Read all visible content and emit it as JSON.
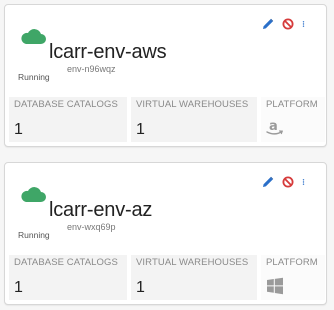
{
  "theme": {
    "cloud_color": "#3fa667",
    "edit_color": "#2a6fc9",
    "disable_color": "#d63b3b",
    "menu_color": "#2a6fc9"
  },
  "environments": [
    {
      "name": "lcarr-env-aws",
      "id": "env-n96wqz",
      "status": "Running",
      "stats": {
        "database_catalogs_label": "DATABASE CATALOGS",
        "database_catalogs_value": "1",
        "virtual_warehouses_label": "VIRTUAL WAREHOUSES",
        "virtual_warehouses_value": "1",
        "platform_label": "PLATFORM",
        "platform_icon": "amazon-icon"
      },
      "actions": [
        "edit-icon",
        "disable-icon",
        "more-vertical-icon"
      ]
    },
    {
      "name": "lcarr-env-az",
      "id": "env-wxq69p",
      "status": "Running",
      "stats": {
        "database_catalogs_label": "DATABASE CATALOGS",
        "database_catalogs_value": "1",
        "virtual_warehouses_label": "VIRTUAL WAREHOUSES",
        "virtual_warehouses_value": "1",
        "platform_label": "PLATFORM",
        "platform_icon": "windows-icon"
      },
      "actions": [
        "edit-icon",
        "disable-icon",
        "more-vertical-icon"
      ]
    }
  ]
}
